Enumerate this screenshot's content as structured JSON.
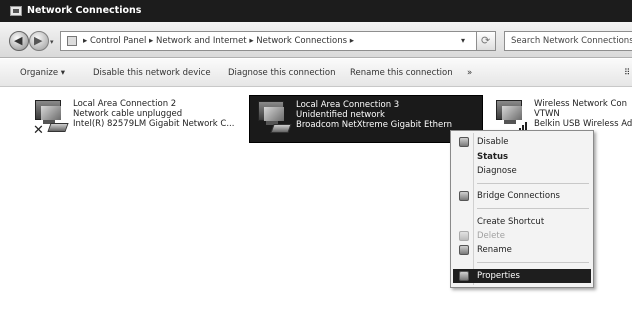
{
  "window": {
    "title": "Network Connections"
  },
  "address": {
    "crumbs": "▸ Control Panel ▸ Network and Internet ▸ Network Connections ▸",
    "search_placeholder": "Search Network Connections"
  },
  "toolbar": {
    "organize": "Organize ▾",
    "disable": "Disable this network device",
    "diagnose": "Diagnose this connection",
    "rename": "Rename this connection",
    "more": "»",
    "view": "⠿"
  },
  "connections": [
    {
      "name": "Local Area Connection 2",
      "status": "Network cable unplugged",
      "adapter": "Intel(R) 82579LM Gigabit Network C..."
    },
    {
      "name": "Local Area Connection 3",
      "status": "Unidentified network",
      "adapter": "Broadcom NetXtreme Gigabit Ethern"
    },
    {
      "name": "Wireless Network Con",
      "status": "VTWN",
      "adapter": "Belkin USB Wireless Ad"
    }
  ],
  "context_menu": {
    "items": [
      {
        "label": "Disable"
      },
      {
        "label": "Status"
      },
      {
        "label": "Diagnose"
      },
      {
        "label": "Bridge Connections"
      },
      {
        "label": "Create Shortcut"
      },
      {
        "label": "Delete"
      },
      {
        "label": "Rename"
      },
      {
        "label": "Properties"
      }
    ]
  }
}
